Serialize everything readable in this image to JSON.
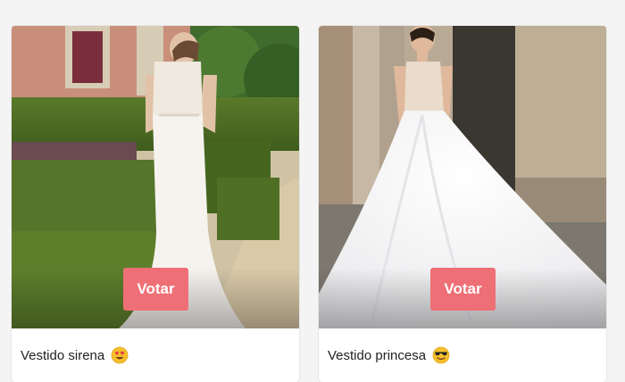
{
  "cards": [
    {
      "title": "Vestido sirena",
      "vote_label": "Votar",
      "emoji": "smiling-face-with-heart-eyes-icon"
    },
    {
      "title": "Vestido princesa",
      "vote_label": "Votar",
      "emoji": "smiling-face-with-sunglasses-icon"
    }
  ],
  "colors": {
    "vote_button": "#ef6f76",
    "card_background": "#ffffff",
    "page_background": "#f4f4f4"
  }
}
